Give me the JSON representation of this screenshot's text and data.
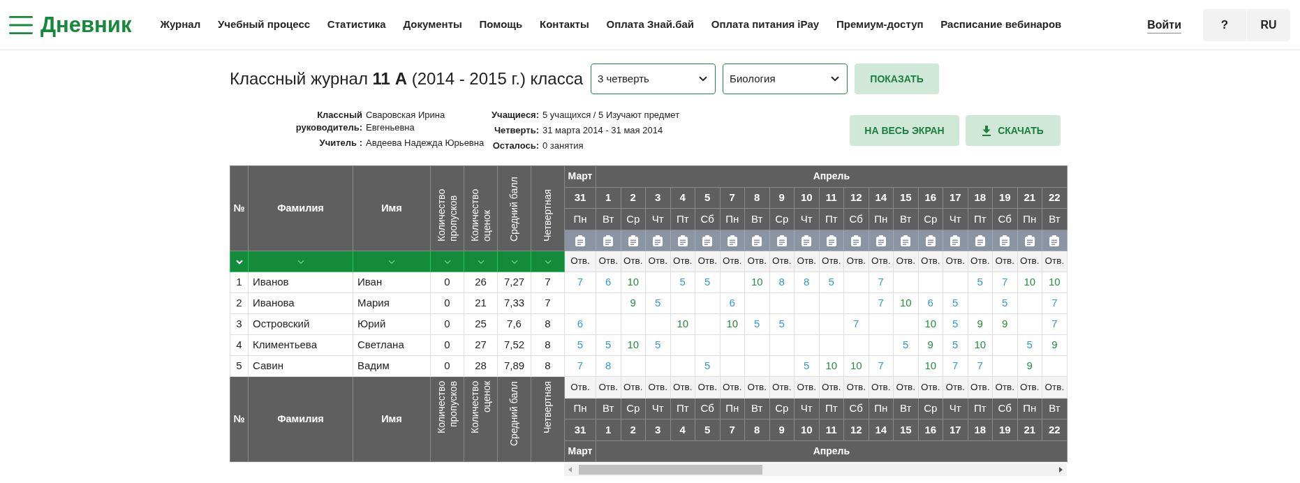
{
  "header": {
    "logo": "Дневник",
    "nav": [
      "Журнал",
      "Учебный процесс",
      "Статистика",
      "Документы",
      "Помощь",
      "Контакты",
      "Оплата Знай.бай",
      "Оплата питания iPay",
      "Премиум-доступ",
      "Расписание вебинаров"
    ],
    "login": "Войти",
    "help_button": "?",
    "language_button": "RU"
  },
  "journal": {
    "title": "Классный журнал **11 А** (2014 - 2015 г.) класса",
    "quarter_select": "3 четверть",
    "subject_select": "Биология",
    "show_button": "ПОКАЗАТЬ"
  },
  "info": {
    "staff": [
      {
        "label": "Классный руководитель:",
        "value": "Сваровская Ирина Евгеньевна"
      },
      {
        "label": "Учитель :",
        "value": "Авдеева Надежда Юрьевна"
      }
    ],
    "summary": [
      {
        "label": "Учащиеся:",
        "value": "5 учащихся / 5 Изучают предмет"
      },
      {
        "label": "Четверть:",
        "value": "31 марта 2014 - 31 мая 2014"
      },
      {
        "label": "Осталось:",
        "value": "0 занятия"
      }
    ]
  },
  "actions": [
    {
      "kind": "fullscreen",
      "label": "НА ВЕСЬ ЭКРАН"
    },
    {
      "kind": "download",
      "label": "СКАЧАТЬ"
    }
  ],
  "table": {
    "columns": [
      {
        "label": "№",
        "kind": "plain",
        "filter_highlighted": true
      },
      {
        "label": "Фамилия",
        "kind": "plain",
        "filter_highlighted": false
      },
      {
        "label": "Имя",
        "kind": "plain",
        "filter_highlighted": false
      },
      {
        "label": "Количество пропусков",
        "kind": "vertical",
        "filter_highlighted": false
      },
      {
        "label": "Количество оценок",
        "kind": "vertical",
        "filter_highlighted": false
      },
      {
        "label": "Средний балл",
        "kind": "vertical",
        "filter_highlighted": false
      },
      {
        "label": "Четвертная",
        "kind": "vertical",
        "filter_highlighted": false
      }
    ],
    "header_months": [
      {
        "label": "Март",
        "days": [
          {
            "date": "31",
            "weekday": "Пн",
            "lesson_type": "Отв."
          }
        ]
      },
      {
        "label": "Апрель",
        "days": [
          {
            "date": "1",
            "weekday": "Вт",
            "lesson_type": "Отв."
          },
          {
            "date": "2",
            "weekday": "Ср",
            "lesson_type": "Отв."
          },
          {
            "date": "3",
            "weekday": "Чт",
            "lesson_type": "Отв."
          },
          {
            "date": "4",
            "weekday": "Пт",
            "lesson_type": "Отв."
          },
          {
            "date": "5",
            "weekday": "Сб",
            "lesson_type": "Отв."
          },
          {
            "date": "7",
            "weekday": "Пн",
            "lesson_type": "Отв."
          },
          {
            "date": "8",
            "weekday": "Вт",
            "lesson_type": "Отв."
          },
          {
            "date": "9",
            "weekday": "Ср",
            "lesson_type": "Отв."
          },
          {
            "date": "10",
            "weekday": "Чт",
            "lesson_type": "Отв."
          },
          {
            "date": "11",
            "weekday": "Пт",
            "lesson_type": "Отв."
          },
          {
            "date": "12",
            "weekday": "Сб",
            "lesson_type": "Отв."
          },
          {
            "date": "14",
            "weekday": "Пн",
            "lesson_type": "Отв."
          },
          {
            "date": "15",
            "weekday": "Вт",
            "lesson_type": "Отв."
          },
          {
            "date": "16",
            "weekday": "Ср",
            "lesson_type": "Отв."
          },
          {
            "date": "17",
            "weekday": "Чт",
            "lesson_type": "Отв."
          },
          {
            "date": "18",
            "weekday": "Пт",
            "lesson_type": "Отв."
          },
          {
            "date": "19",
            "weekday": "Сб",
            "lesson_type": "Отв."
          },
          {
            "date": "21",
            "weekday": "Пн",
            "lesson_type": "Отв."
          },
          {
            "date": "22",
            "weekday": "Вт",
            "lesson_type": "Отв."
          }
        ]
      }
    ],
    "rows": [
      {
        "number": "1",
        "surname": "Иванов",
        "first_name": "Иван",
        "absences": "0",
        "grade_count": "26",
        "average": "7,27",
        "quarter_grade": "7",
        "grades": [
          {
            "kind": "grade",
            "value": "7",
            "color": "#2d9bd8"
          },
          {
            "kind": "grade",
            "value": "6",
            "color": "#2d9bd8"
          },
          {
            "kind": "grade",
            "value": "10",
            "color": "#1f8f3a"
          },
          {
            "kind": "blank"
          },
          {
            "kind": "grade",
            "value": "5",
            "color": "#2d9bd8"
          },
          {
            "kind": "grade",
            "value": "5",
            "color": "#2d9bd8"
          },
          {
            "kind": "blank"
          },
          {
            "kind": "grade",
            "value": "10",
            "color": "#1f8f3a"
          },
          {
            "kind": "grade",
            "value": "8",
            "color": "#2d9bd8"
          },
          {
            "kind": "grade",
            "value": "8",
            "color": "#2d9bd8"
          },
          {
            "kind": "grade",
            "value": "5",
            "color": "#2d9bd8"
          },
          {
            "kind": "blank"
          },
          {
            "kind": "grade",
            "value": "7",
            "color": "#2d9bd8"
          },
          {
            "kind": "blank"
          },
          {
            "kind": "blank"
          },
          {
            "kind": "blank"
          },
          {
            "kind": "grade",
            "value": "5",
            "color": "#2d9bd8"
          },
          {
            "kind": "grade",
            "value": "7",
            "color": "#2d9bd8"
          },
          {
            "kind": "grade",
            "value": "10",
            "color": "#1f8f3a"
          },
          {
            "kind": "grade",
            "value": "10",
            "color": "#1f8f3a"
          }
        ]
      },
      {
        "number": "2",
        "surname": "Иванова",
        "first_name": "Мария",
        "absences": "0",
        "grade_count": "21",
        "average": "7,33",
        "quarter_grade": "7",
        "grades": [
          {
            "kind": "blank"
          },
          {
            "kind": "blank"
          },
          {
            "kind": "grade",
            "value": "9",
            "color": "#1f8f3a"
          },
          {
            "kind": "grade",
            "value": "5",
            "color": "#2d9bd8"
          },
          {
            "kind": "blank"
          },
          {
            "kind": "blank"
          },
          {
            "kind": "grade",
            "value": "6",
            "color": "#2d9bd8"
          },
          {
            "kind": "blank"
          },
          {
            "kind": "blank"
          },
          {
            "kind": "blank"
          },
          {
            "kind": "blank"
          },
          {
            "kind": "blank"
          },
          {
            "kind": "grade",
            "value": "7",
            "color": "#2d9bd8"
          },
          {
            "kind": "grade",
            "value": "10",
            "color": "#1f8f3a"
          },
          {
            "kind": "grade",
            "value": "6",
            "color": "#2d9bd8"
          },
          {
            "kind": "grade",
            "value": "5",
            "color": "#2d9bd8"
          },
          {
            "kind": "blank"
          },
          {
            "kind": "grade",
            "value": "5",
            "color": "#2d9bd8"
          },
          {
            "kind": "blank"
          },
          {
            "kind": "grade",
            "value": "7",
            "color": "#2d9bd8"
          }
        ]
      },
      {
        "number": "3",
        "surname": "Островский",
        "first_name": "Юрий",
        "absences": "0",
        "grade_count": "25",
        "average": "7,6",
        "quarter_grade": "8",
        "grades": [
          {
            "kind": "grade",
            "value": "6",
            "color": "#2d9bd8"
          },
          {
            "kind": "blank"
          },
          {
            "kind": "blank"
          },
          {
            "kind": "blank"
          },
          {
            "kind": "grade",
            "value": "10",
            "color": "#1f8f3a"
          },
          {
            "kind": "blank"
          },
          {
            "kind": "grade",
            "value": "10",
            "color": "#1f8f3a"
          },
          {
            "kind": "grade",
            "value": "5",
            "color": "#2d9bd8"
          },
          {
            "kind": "grade",
            "value": "5",
            "color": "#2d9bd8"
          },
          {
            "kind": "blank"
          },
          {
            "kind": "blank"
          },
          {
            "kind": "grade",
            "value": "7",
            "color": "#2d9bd8"
          },
          {
            "kind": "blank"
          },
          {
            "kind": "blank"
          },
          {
            "kind": "grade",
            "value": "10",
            "color": "#1f8f3a"
          },
          {
            "kind": "grade",
            "value": "5",
            "color": "#2d9bd8"
          },
          {
            "kind": "grade",
            "value": "9",
            "color": "#1f8f3a"
          },
          {
            "kind": "grade",
            "value": "9",
            "color": "#1f8f3a"
          },
          {
            "kind": "blank"
          },
          {
            "kind": "grade",
            "value": "7",
            "color": "#2d9bd8"
          }
        ]
      },
      {
        "number": "4",
        "surname": "Климентьева",
        "first_name": "Светлана",
        "absences": "0",
        "grade_count": "27",
        "average": "7,52",
        "quarter_grade": "8",
        "grades": [
          {
            "kind": "grade",
            "value": "5",
            "color": "#2d9bd8"
          },
          {
            "kind": "grade",
            "value": "5",
            "color": "#2d9bd8"
          },
          {
            "kind": "grade",
            "value": "10",
            "color": "#1f8f3a"
          },
          {
            "kind": "grade",
            "value": "5",
            "color": "#2d9bd8"
          },
          {
            "kind": "blank"
          },
          {
            "kind": "blank"
          },
          {
            "kind": "blank"
          },
          {
            "kind": "blank"
          },
          {
            "kind": "blank"
          },
          {
            "kind": "blank"
          },
          {
            "kind": "blank"
          },
          {
            "kind": "blank"
          },
          {
            "kind": "blank"
          },
          {
            "kind": "grade",
            "value": "5",
            "color": "#2d9bd8"
          },
          {
            "kind": "grade",
            "value": "9",
            "color": "#1f8f3a"
          },
          {
            "kind": "grade",
            "value": "5",
            "color": "#2d9bd8"
          },
          {
            "kind": "grade",
            "value": "10",
            "color": "#1f8f3a"
          },
          {
            "kind": "blank"
          },
          {
            "kind": "grade",
            "value": "5",
            "color": "#2d9bd8"
          },
          {
            "kind": "grade",
            "value": "9",
            "color": "#1f8f3a"
          }
        ]
      },
      {
        "number": "5",
        "surname": "Савин",
        "first_name": "Вадим",
        "absences": "0",
        "grade_count": "28",
        "average": "7,89",
        "quarter_grade": "8",
        "grades": [
          {
            "kind": "grade",
            "value": "7",
            "color": "#2d9bd8"
          },
          {
            "kind": "grade",
            "value": "8",
            "color": "#2d9bd8"
          },
          {
            "kind": "blank"
          },
          {
            "kind": "blank"
          },
          {
            "kind": "blank"
          },
          {
            "kind": "grade",
            "value": "5",
            "color": "#2d9bd8"
          },
          {
            "kind": "blank"
          },
          {
            "kind": "blank"
          },
          {
            "kind": "blank"
          },
          {
            "kind": "grade",
            "value": "5",
            "color": "#2d9bd8"
          },
          {
            "kind": "grade",
            "value": "10",
            "color": "#1f8f3a"
          },
          {
            "kind": "grade",
            "value": "10",
            "color": "#1f8f3a"
          },
          {
            "kind": "grade",
            "value": "7",
            "color": "#2d9bd8"
          },
          {
            "kind": "blank"
          },
          {
            "kind": "grade",
            "value": "10",
            "color": "#1f8f3a"
          },
          {
            "kind": "grade",
            "value": "7",
            "color": "#2d9bd8"
          },
          {
            "kind": "grade",
            "value": "7",
            "color": "#2d9bd8"
          },
          {
            "kind": "blank"
          },
          {
            "kind": "grade",
            "value": "9",
            "color": "#1f8f3a"
          },
          {
            "kind": "blank"
          }
        ]
      }
    ],
    "footer_columns": [
      {
        "label": "№",
        "kind": "plain"
      },
      {
        "label": "Фамилия",
        "kind": "plain"
      },
      {
        "label": "Имя",
        "kind": "plain"
      },
      {
        "label": "Количество пропусков",
        "kind": "vertical"
      },
      {
        "label": "Количество оценок",
        "kind": "vertical"
      },
      {
        "label": "Средний балл",
        "kind": "vertical"
      },
      {
        "label": "Четвертная",
        "kind": "vertical"
      }
    ],
    "footer_months": [
      {
        "label": "Март",
        "days": [
          {
            "date": "31",
            "weekday": "Пн",
            "lesson_type": "Отв."
          }
        ]
      },
      {
        "label": "Апрель",
        "days": [
          {
            "date": "1",
            "weekday": "Вт",
            "lesson_type": "Отв."
          },
          {
            "date": "2",
            "weekday": "Ср",
            "lesson_type": "Отв."
          },
          {
            "date": "3",
            "weekday": "Чт",
            "lesson_type": "Отв."
          },
          {
            "date": "4",
            "weekday": "Пт",
            "lesson_type": "Отв."
          },
          {
            "date": "5",
            "weekday": "Сб",
            "lesson_type": "Отв."
          },
          {
            "date": "7",
            "weekday": "Пн",
            "lesson_type": "Отв."
          },
          {
            "date": "8",
            "weekday": "Вт",
            "lesson_type": "Отв."
          },
          {
            "date": "9",
            "weekday": "Ср",
            "lesson_type": "Отв."
          },
          {
            "date": "10",
            "weekday": "Чт",
            "lesson_type": "Отв."
          },
          {
            "date": "11",
            "weekday": "Пт",
            "lesson_type": "Отв."
          },
          {
            "date": "12",
            "weekday": "Сб",
            "lesson_type": "Отв."
          },
          {
            "date": "14",
            "weekday": "Пн",
            "lesson_type": "Отв."
          },
          {
            "date": "15",
            "weekday": "Вт",
            "lesson_type": "Отв."
          },
          {
            "date": "16",
            "weekday": "Ср",
            "lesson_type": "Отв."
          },
          {
            "date": "17",
            "weekday": "Чт",
            "lesson_type": "Отв."
          },
          {
            "date": "18",
            "weekday": "Пт",
            "lesson_type": "Отв."
          },
          {
            "date": "19",
            "weekday": "Сб",
            "lesson_type": "Отв."
          },
          {
            "date": "21",
            "weekday": "Пн",
            "lesson_type": "Отв."
          },
          {
            "date": "22",
            "weekday": "Вт",
            "lesson_type": "Отв."
          }
        ]
      }
    ]
  }
}
